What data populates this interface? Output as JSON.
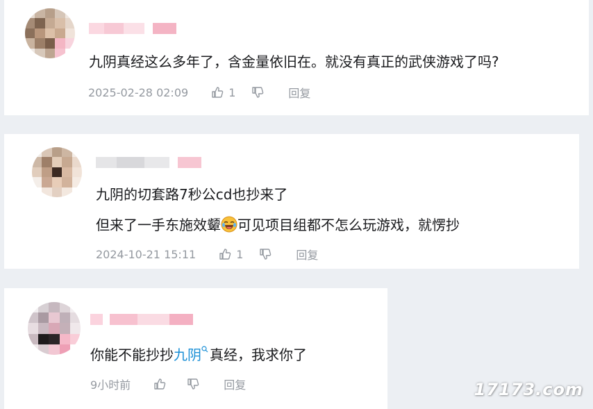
{
  "comments": [
    {
      "text": "九阴真经这么多年了，含金量依旧在。就没有真正的武侠游戏了吗?",
      "time": "2025-02-28 02:09",
      "likes": "1",
      "reply_label": "回复"
    },
    {
      "text_line1": "九阴的切套路7秒公cd也抄来了",
      "text_line2_before": "但来了一手东施效颦",
      "text_line2_after": "可见项目组都不怎么玩游戏，就愣抄",
      "emoji": "laughing-crying-emoji",
      "time": "2024-10-21 15:11",
      "likes": "1",
      "reply_label": "回复"
    },
    {
      "text_before": "你能不能抄抄",
      "link_text": "九阴",
      "text_after": "真经，我求你了",
      "time": "9小时前",
      "reply_label": "回复"
    }
  ],
  "watermark": "17173.com",
  "colors": {
    "link": "#1a8fd6",
    "meta": "#9499a0",
    "text": "#18191c"
  }
}
